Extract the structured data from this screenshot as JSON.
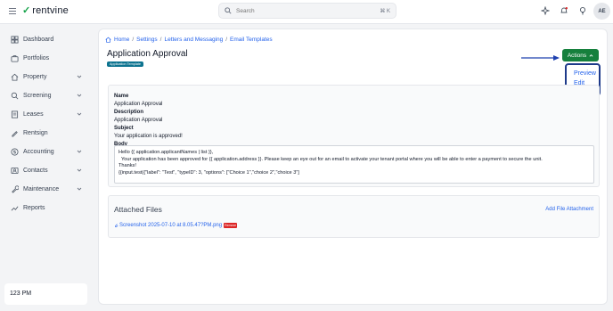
{
  "app": {
    "name": "rentvine"
  },
  "search": {
    "placeholder": "Search",
    "shortcut": "⌘ K"
  },
  "user": {
    "initials": "AE"
  },
  "sidebar": {
    "items": [
      {
        "label": "Dashboard",
        "icon": "dashboard-icon",
        "expandable": false
      },
      {
        "label": "Portfolios",
        "icon": "portfolios-icon",
        "expandable": false
      },
      {
        "label": "Property",
        "icon": "property-icon",
        "expandable": true
      },
      {
        "label": "Screening",
        "icon": "screening-icon",
        "expandable": true
      },
      {
        "label": "Leases",
        "icon": "leases-icon",
        "expandable": true
      },
      {
        "label": "Rentsign",
        "icon": "rentsign-icon",
        "expandable": false
      },
      {
        "label": "Accounting",
        "icon": "accounting-icon",
        "expandable": true
      },
      {
        "label": "Contacts",
        "icon": "contacts-icon",
        "expandable": true
      },
      {
        "label": "Maintenance",
        "icon": "maintenance-icon",
        "expandable": true
      },
      {
        "label": "Reports",
        "icon": "reports-icon",
        "expandable": false
      }
    ],
    "clock": "123 PM"
  },
  "breadcrumb": [
    "Home",
    "Settings",
    "Letters and Messaging",
    "Email Templates"
  ],
  "page": {
    "title": "Application Approval",
    "badge": "Application Template"
  },
  "actions": {
    "label": "Actions",
    "menu": [
      "Preview",
      "Edit"
    ]
  },
  "template": {
    "name_label": "Name",
    "name": "Application Approval",
    "description_label": "Description",
    "description": "Application Approval",
    "subject_label": "Subject",
    "subject": "Your application is approved!",
    "body_label": "Body",
    "body_lines": [
      "Hello {{ application.applicantNames | list }},",
      "  Your application has been approved for {{ application.address }}. Please keep an eye out for an email to activate your tenant portal where you will be able to enter a payment to secure the unit.",
      "Thanks!",
      "{{input.test({\"label\": \"Test\", \"typeID\": 3, \"options\": [\"Choice 1\",\"choice 2\",\"choice 3\"]"
    ]
  },
  "attachments": {
    "title": "Attached Files",
    "add_label": "Add File Attachment",
    "files": [
      {
        "name": "Screenshot 2025-07-10 at 8.05.47?PM.png",
        "remove_label": "Remove"
      }
    ]
  },
  "colors": {
    "accent": "#16803d",
    "link": "#2563eb",
    "highlight": "#1e3a8a",
    "badge": "#0e7490",
    "danger": "#dc2626"
  }
}
